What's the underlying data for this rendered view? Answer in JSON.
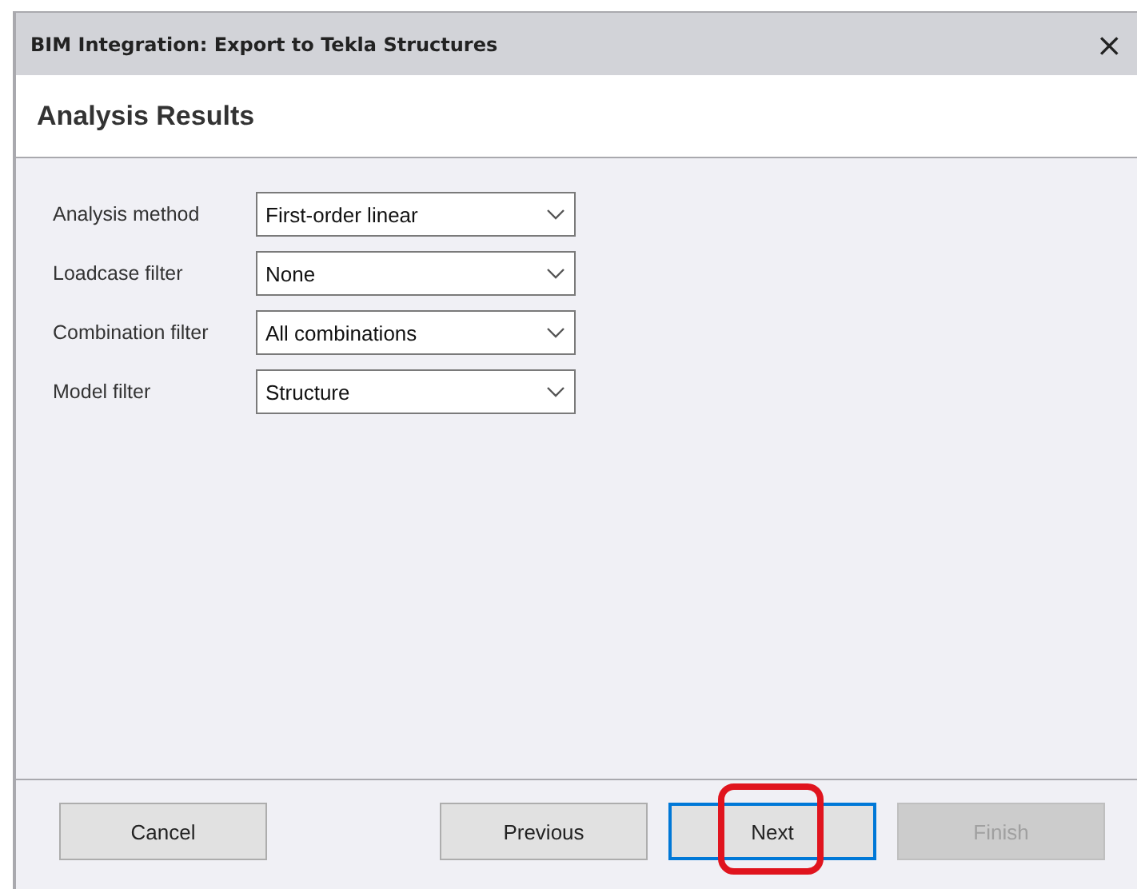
{
  "window": {
    "title": "BIM Integration: Export to Tekla Structures",
    "close": "×"
  },
  "header": {
    "title": "Analysis Results"
  },
  "fields": [
    {
      "label": "Analysis method",
      "value": "First-order linear"
    },
    {
      "label": "Loadcase filter",
      "value": "None"
    },
    {
      "label": "Combination filter",
      "value": "All combinations"
    },
    {
      "label": "Model filter",
      "value": "Structure"
    }
  ],
  "footer": {
    "left_buttons": [
      {
        "label": "Cancel",
        "disabled": false,
        "focused": false,
        "highlighted": false
      }
    ],
    "right_buttons": [
      {
        "label": "Previous",
        "disabled": false,
        "focused": false,
        "highlighted": false
      },
      {
        "label": "Next",
        "disabled": false,
        "focused": true,
        "highlighted": true
      },
      {
        "label": "Finish",
        "disabled": true,
        "focused": false,
        "highlighted": false
      }
    ]
  }
}
